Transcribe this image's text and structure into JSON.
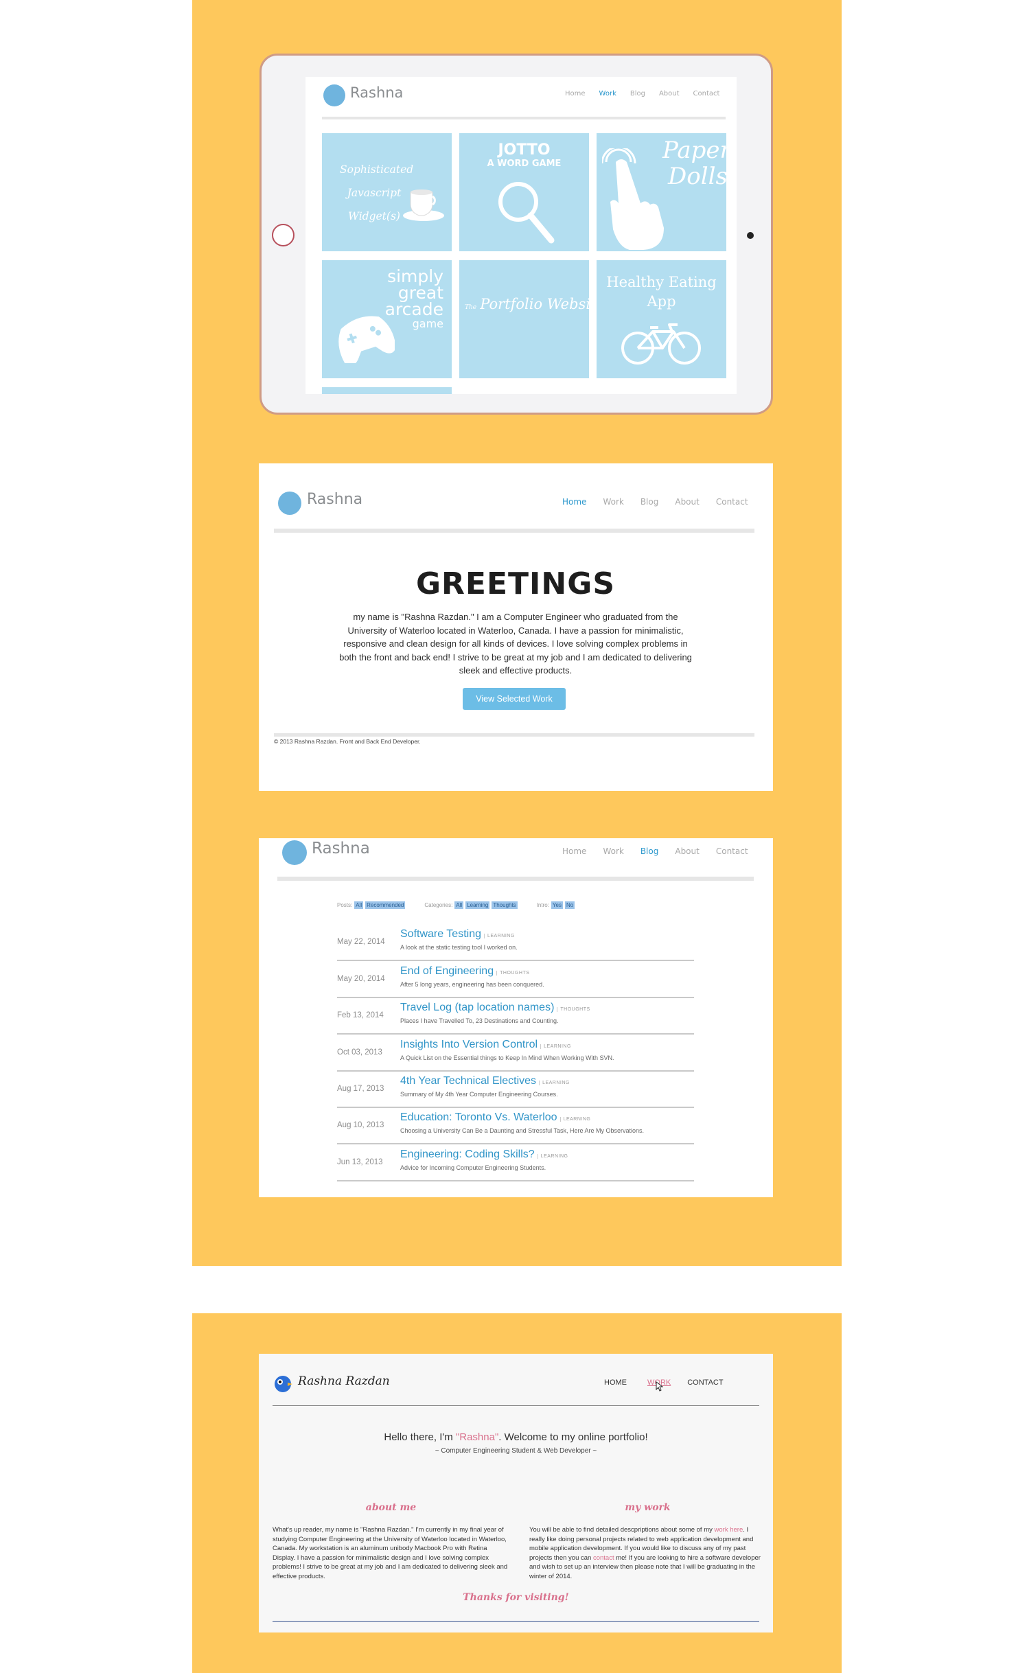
{
  "ipad_page": {
    "logo_text": "Rashna",
    "nav": [
      "Home",
      "Work",
      "Blog",
      "About",
      "Contact"
    ],
    "active_nav": "Work",
    "tiles": [
      {
        "lines": [
          "Sophisticated",
          "Javascript",
          "Widget(s)"
        ]
      },
      {
        "lines": [
          "JOTTO",
          "A WORD GAME"
        ]
      },
      {
        "lines": [
          "Paper",
          "Dolls"
        ]
      },
      {
        "lines": [
          "simply",
          "great",
          "arcade",
          "game"
        ]
      },
      {
        "lines": [
          "The",
          "Portfolio Website"
        ]
      },
      {
        "lines": [
          "Healthy Eating",
          "App"
        ]
      }
    ]
  },
  "home_page": {
    "logo_text": "Rashna",
    "nav": [
      "Home",
      "Work",
      "Blog",
      "About",
      "Contact"
    ],
    "active_nav": "Home",
    "title": "GREETINGS",
    "body": "my name is \"Rashna Razdan.\" I am a Computer Engineer who graduated from the University of Waterloo located in Waterloo, Canada. I have a passion for minimalistic, responsive and clean design for all kinds of devices. I love solving complex problems in both the front and back end! I strive to be great at my job and I am dedicated to delivering sleek and effective products.",
    "button": "View Selected Work",
    "footer": "© 2013 Rashna Razdan. Front and Back End Developer."
  },
  "blog_page": {
    "logo_text": "Rashna",
    "nav": [
      "Home",
      "Work",
      "Blog",
      "About",
      "Contact"
    ],
    "active_nav": "Blog",
    "filters": {
      "posts_label": "Posts:",
      "posts_options": [
        "All",
        "Recommended"
      ],
      "categories_label": "Categories:",
      "categories_options": [
        "All",
        "Learning",
        "Thoughts"
      ],
      "intro_label": "Intro:",
      "intro_options": [
        "Yes",
        "No"
      ]
    },
    "posts": [
      {
        "date": "May 22, 2014",
        "title": "Software Testing",
        "tag": "LEARNING",
        "summary": "A look at the static testing tool I worked on."
      },
      {
        "date": "May 20, 2014",
        "title": "End of Engineering",
        "tag": "THOUGHTS",
        "summary": "After 5 long years, engineering has been conquered."
      },
      {
        "date": "Feb 13, 2014",
        "title": "Travel Log (tap location names)",
        "tag": "THOUGHTS",
        "summary": "Places I have Travelled To, 23 Destinations and Counting."
      },
      {
        "date": "Oct 03, 2013",
        "title": "Insights Into Version Control",
        "tag": "LEARNING",
        "summary": "A Quick List on the Essential things to Keep In Mind When Working With SVN."
      },
      {
        "date": "Aug 17, 2013",
        "title": "4th Year Technical Electives",
        "tag": "LEARNING",
        "summary": "Summary of My 4th Year Computer Engineering Courses."
      },
      {
        "date": "Aug 10, 2013",
        "title": "Education: Toronto Vs. Waterloo",
        "tag": "LEARNING",
        "summary": "Choosing a University Can Be a Daunting and Stressful Task, Here Are My Observations."
      },
      {
        "date": "Jun 13, 2013",
        "title": "Engineering: Coding Skills?",
        "tag": "LEARNING",
        "summary": "Advice for Incoming Computer Engineering Students."
      }
    ]
  },
  "portfolio_page": {
    "name": "Rashna Razdan",
    "nav": [
      "HOME",
      "WORK",
      "CONTACT"
    ],
    "active_nav": "WORK",
    "hello_pre": "Hello there, I'm ",
    "hello_name": "\"Rashna\"",
    "hello_post": ". Welcome to my online portfolio!",
    "tagline": "~ Computer Engineering Student & Web Developer ~",
    "about_heading": "about me",
    "about_text": "What's up reader, my name is \"Rashna Razdan.\" I'm currently in my final year of studying Computer Engineering at the University of Waterloo located in Waterloo, Canada. My workstation is an aluminum unibody Macbook Pro with Retina Display. I have a passion for minimalistic design and I love solving complex problems! I strive to be great at my job and I am dedicated to delivering sleek and effective products.",
    "work_heading": "my work",
    "work_text_1": "You will be able to find detailed descpriptions about some of my ",
    "work_link_1": "work here",
    "work_text_2": ". I really like doing personal projects related to web application development and mobile application development. If you would like to discuss any of my past projects then you can ",
    "work_link_2": "contact",
    "work_text_3": " me! If you are looking to hire a software developer and wish to set up an interview then please note that I will be graduating in the winter of 2014.",
    "thanks": "Thanks for visiting!"
  },
  "colors": {
    "panel_bg": "#fec85c",
    "tile_bg": "#b3def0",
    "link_blue": "#3195c8",
    "pink": "#d9708c"
  }
}
